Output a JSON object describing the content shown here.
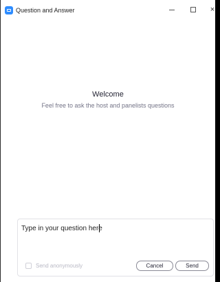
{
  "window": {
    "title": "Question and Answer",
    "controls": {
      "minimize": "minimize",
      "maximize": "maximize",
      "close": "×"
    }
  },
  "welcome": {
    "heading": "Welcome",
    "subtitle": "Feel free to ask the host and panelists questions"
  },
  "compose": {
    "placeholder": "Type in your question here",
    "value": "",
    "anonymous_label": "Send anonymously",
    "anonymous_checked": false,
    "cancel_label": "Cancel",
    "send_label": "Send"
  },
  "colors": {
    "accent": "#2d8cff",
    "text_primary": "#232333",
    "text_secondary": "#747487",
    "disabled": "#b8b8c4"
  },
  "icons": {
    "app": "zoom-app-icon"
  }
}
